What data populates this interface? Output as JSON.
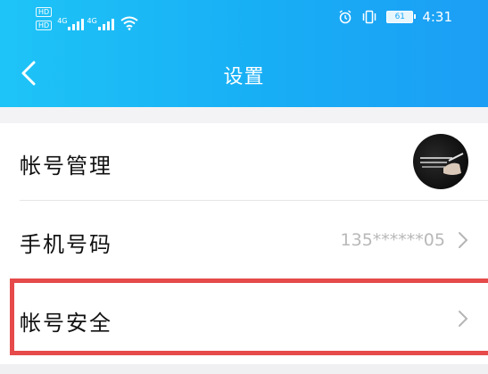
{
  "status_bar": {
    "left_badges": [
      "HD",
      "HD"
    ],
    "network_labels": [
      "4G",
      "4G"
    ],
    "battery": "61",
    "time": "4:31",
    "alarm_icon": "alarm-icon",
    "vibrate_icon": "vibrate-icon",
    "wifi_icon": "wifi-icon"
  },
  "nav": {
    "title": "设置",
    "back_icon": "chevron-left-icon"
  },
  "settings": {
    "items": [
      {
        "label": "帐号管理",
        "value": "",
        "has_avatar": true
      },
      {
        "label": "手机号码",
        "value": "135******05",
        "has_chevron": true
      },
      {
        "label": "帐号安全",
        "value": "",
        "has_chevron": true,
        "highlighted": true
      }
    ]
  },
  "colors": {
    "header_start": "#1ec4f7",
    "header_end": "#1c9ef5",
    "highlight": "#e64a4a",
    "value_text": "#b8b8b8"
  }
}
